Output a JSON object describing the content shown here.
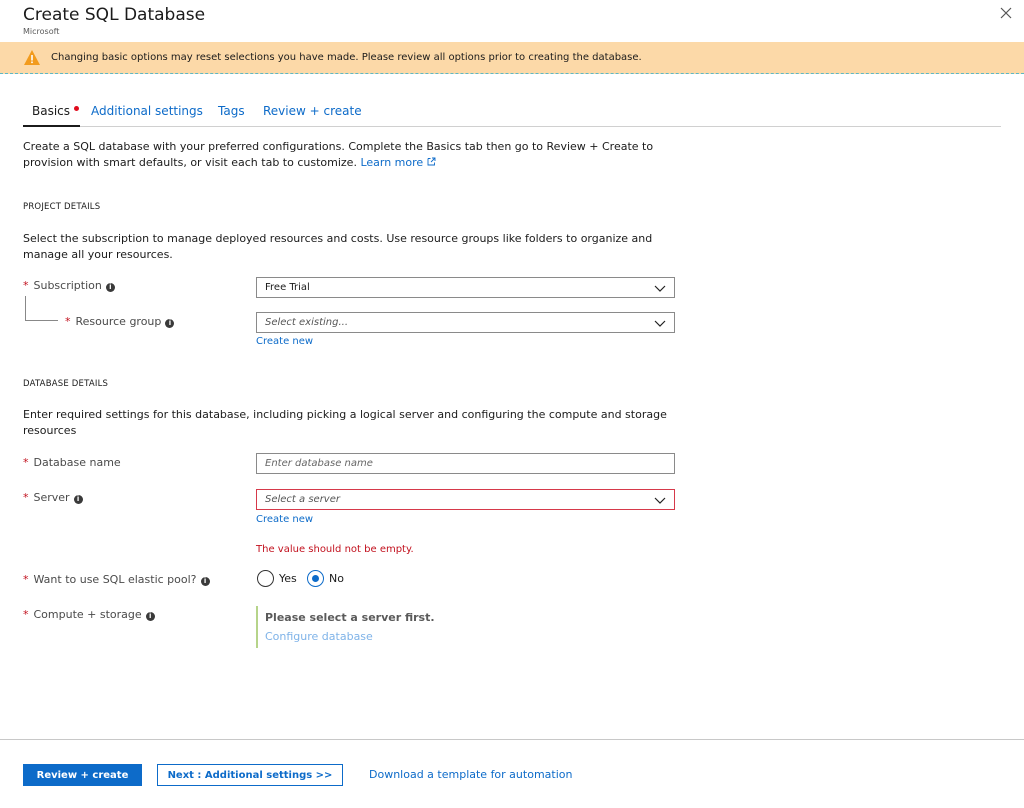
{
  "window": {
    "title": "Create SQL Database",
    "publisher": "Microsoft"
  },
  "warning": {
    "text": "Changing basic options may reset selections you have made. Please review all options prior to creating the database."
  },
  "tabs": [
    {
      "label": "Basics"
    },
    {
      "label": "Additional settings"
    },
    {
      "label": "Tags"
    },
    {
      "label": "Review + create"
    }
  ],
  "intro": {
    "text": "Create a SQL database with your preferred configurations. Complete the Basics tab then go to Review + Create to provision with smart defaults, or visit each tab to customize.",
    "learn_more": "Learn more"
  },
  "project": {
    "heading": "PROJECT DETAILS",
    "description": "Select the subscription to manage deployed resources and costs. Use resource groups like folders to organize and manage all your resources.",
    "subscription_label": "Subscription",
    "subscription_value": "Free Trial",
    "resource_group_label": "Resource group",
    "resource_group_placeholder": "Select existing...",
    "create_new": "Create new"
  },
  "database": {
    "heading": "DATABASE DETAILS",
    "description": "Enter required settings for this database, including picking a logical server and configuring the compute and storage resources",
    "name_label": "Database name",
    "name_placeholder": "Enter database name",
    "server_label": "Server",
    "server_placeholder": "Select a server",
    "create_new": "Create new",
    "server_error": "The value should not be empty.",
    "elastic_label": "Want to use SQL elastic pool?",
    "elastic_yes": "Yes",
    "elastic_no": "No",
    "elastic_selected": "No",
    "compute_label": "Compute + storage",
    "compute_message": "Please select a server first.",
    "compute_link": "Configure database"
  },
  "footer": {
    "review_create": "Review + create",
    "next": "Next : Additional settings >>",
    "download": "Download a template for automation"
  },
  "colors": {
    "accent": "#0d6bc9",
    "warning_bg": "#fcd9a8",
    "error": "#c2111e"
  }
}
